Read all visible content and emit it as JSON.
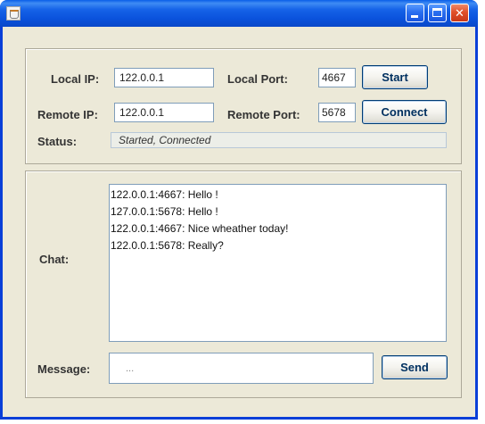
{
  "window": {
    "title": ""
  },
  "connection": {
    "local_ip_label": "Local IP:",
    "local_ip_value": "122.0.0.1",
    "local_port_label": "Local Port:",
    "local_port_value": "4667",
    "start_label": "Start",
    "remote_ip_label": "Remote IP:",
    "remote_ip_value": "122.0.0.1",
    "remote_port_label": "Remote Port:",
    "remote_port_value": "5678",
    "connect_label": "Connect",
    "status_label": "Status:",
    "status_value": "Started, Connected"
  },
  "chat": {
    "label": "Chat:",
    "messages": [
      "122.0.0.1:4667:  Hello !",
      "127.0.0.1:5678:  Hello !",
      "122.0.0.1:4667:  Nice wheather today!",
      "122.0.0.1:5678:  Really?"
    ]
  },
  "message": {
    "label": "Message:",
    "value": "...",
    "send_label": "Send"
  },
  "colors": {
    "titlebar": "#0a52dc",
    "window_border": "#0a3fd8",
    "panel_background": "#ece9d8",
    "button_text": "#003060",
    "close_button": "#e0502a"
  },
  "icons": {
    "app": "java-coffee-cup-icon",
    "minimize": "minimize-icon",
    "maximize": "maximize-icon",
    "close": "close-icon"
  }
}
